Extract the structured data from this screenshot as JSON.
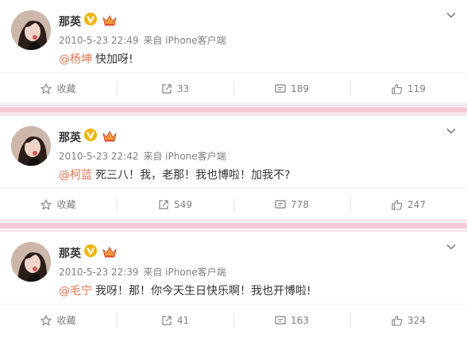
{
  "posts": [
    {
      "author": "那英",
      "time": "2010-5-23 22:49",
      "source": "来自 iPhone客户端",
      "mention": "@杨坤",
      "text": "快加呀!",
      "actions": {
        "favorite": "收藏",
        "repost": "33",
        "comment": "189",
        "like": "119"
      }
    },
    {
      "author": "那英",
      "time": "2010-5-23 22:42",
      "source": "来自 iPhone客户端",
      "mention": "@柯蓝",
      "text": "死三八！我，老那！我也博啦！加我不?",
      "actions": {
        "favorite": "收藏",
        "repost": "549",
        "comment": "778",
        "like": "247"
      }
    },
    {
      "author": "那英",
      "time": "2010-5-23 22:39",
      "source": "来自 iPhone客户端",
      "mention": "@毛宁",
      "text": "我呀！那！你今天生日快乐啊！我也开博啦!",
      "actions": {
        "favorite": "收藏",
        "repost": "41",
        "comment": "163",
        "like": "324"
      }
    }
  ],
  "colors": {
    "mention": "#eb7350",
    "separator": "#f5c8d6",
    "meta": "#808080"
  },
  "icons": [
    "chevron-down-icon",
    "verified-v-icon",
    "crown-icon",
    "star-icon",
    "repost-icon",
    "comment-icon",
    "like-icon"
  ]
}
